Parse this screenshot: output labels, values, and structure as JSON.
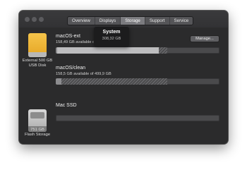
{
  "tabs": [
    {
      "label": "Overview",
      "active": false
    },
    {
      "label": "Displays",
      "active": false
    },
    {
      "label": "Storage",
      "active": true
    },
    {
      "label": "Support",
      "active": false
    },
    {
      "label": "Service",
      "active": false
    }
  ],
  "disks": [
    {
      "caption_line1": "External 500 GB",
      "caption_line2": "USB Disk",
      "icon": "orange-external-drive-icon",
      "volumes": [
        {
          "name": "macOS-ext",
          "available": "158,49 GB available of 499,9 GB",
          "usage": {
            "system_fraction": 0.01,
            "used_fraction": 0.63,
            "other_fraction": 0.05
          }
        },
        {
          "name": "macOS/clean",
          "available": "158,5 GB available of 499,9 GB",
          "usage": {
            "system_fraction": 0.03,
            "used_fraction": 0.0,
            "other_fraction": 0.65
          }
        }
      ],
      "manage_label": "Manage..."
    },
    {
      "caption_line1": "751 GB",
      "caption_line2": "Flash Storage",
      "icon": "internal-ssd-icon",
      "volumes": [
        {
          "name": "Mac SSD",
          "available": "",
          "usage": {
            "system_fraction": 0.0,
            "used_fraction": 0.0,
            "other_fraction": 0.0
          }
        }
      ]
    }
  ],
  "tooltip": {
    "title": "System",
    "size": "308,32 GB"
  },
  "colors": {
    "window_bg": "#2b2b2c",
    "system_segment": "#8c8c8f",
    "used_segment": "#bdbdbf",
    "drive_orange": "#f0b73a"
  }
}
